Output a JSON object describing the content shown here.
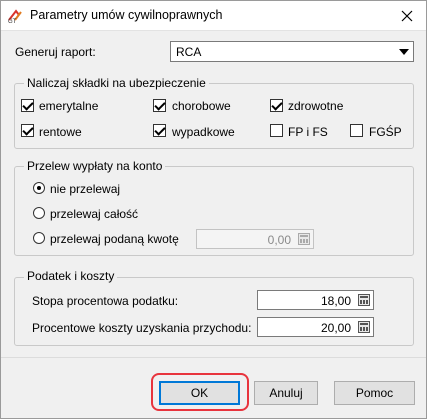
{
  "window": {
    "title": "Parametry umów cywilnoprawnych",
    "icon": "app-logo-icon",
    "close_icon": "close-icon"
  },
  "report": {
    "label": "Generuj raport:",
    "value": "RCA"
  },
  "contributions": {
    "legend": "Naliczaj składki na ubezpieczenie",
    "items": [
      {
        "label": "emerytalne",
        "checked": true
      },
      {
        "label": "chorobowe",
        "checked": true
      },
      {
        "label": "zdrowotne",
        "checked": true
      },
      {
        "label": "rentowe",
        "checked": true
      },
      {
        "label": "wypadkowe",
        "checked": true
      },
      {
        "label": "FP i FS",
        "checked": false
      },
      {
        "label": "FGŚP",
        "checked": false
      }
    ]
  },
  "transfer": {
    "legend": "Przelew wypłaty na konto",
    "options": [
      {
        "label": "nie przelewaj",
        "selected": true
      },
      {
        "label": "przelewaj całość",
        "selected": false
      },
      {
        "label": "przelewaj podaną kwotę",
        "selected": false
      }
    ],
    "amount": "0,00"
  },
  "tax": {
    "legend": "Podatek i koszty",
    "rate_label": "Stopa procentowa podatku:",
    "rate_value": "18,00",
    "costs_label": "Procentowe koszty uzyskania przychodu:",
    "costs_value": "20,00"
  },
  "buttons": {
    "ok": "OK",
    "cancel": "Anuluj",
    "help": "Pomoc"
  },
  "colors": {
    "highlight": "#e8343d",
    "focus": "#0078d7"
  }
}
